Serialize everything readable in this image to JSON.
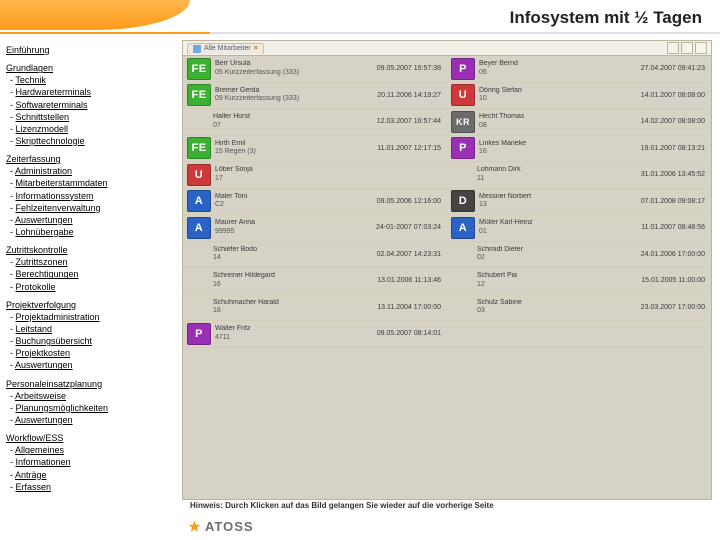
{
  "header": {
    "title": "Infosystem mit ½ Tagen"
  },
  "nav": [
    {
      "title": "Einführung",
      "items": []
    },
    {
      "title": "Grundlagen",
      "items": [
        "Technik",
        "Hardwareterminals",
        "Softwareterminals",
        "Schnittstellen",
        "Lizenzmodell",
        "Skripttechnologie"
      ]
    },
    {
      "title": "Zeiterfassung",
      "items": [
        "Administration",
        "Mitarbeiterstammdaten",
        "Informationssystem",
        "Fehlzeitenverwaltung",
        "Auswertungen",
        "Lohnübergabe"
      ]
    },
    {
      "title": "Zutrittskontrolle",
      "items": [
        "Zutrittszonen",
        "Berechtigungen",
        "Protokolle"
      ]
    },
    {
      "title": "Projektverfolgung",
      "items": [
        "Projektadministration",
        "Leitstand",
        "Buchungsübersicht",
        "Projektkosten",
        "Auswertungen"
      ]
    },
    {
      "title": "Personaleinsatzplanung",
      "items": [
        "Arbeitsweise",
        "Planungsmöglichkeiten",
        "Auswertungen"
      ]
    },
    {
      "title": "Workflow/ESS",
      "items": [
        "Allgemeines",
        "Informationen",
        "Anträge",
        "Erfassen"
      ]
    }
  ],
  "tabs": {
    "active": "Alle Mitarbeiter"
  },
  "rows": [
    {
      "left": {
        "badge": "FE",
        "name": "Berr Ursula",
        "sub": "05",
        "extra": "Kurzzeiterfassung (333)",
        "time": "09.05.2007 15:57:38"
      },
      "right": {
        "badge": "P",
        "name": "Beyer Bernd",
        "sub": "06",
        "time": "27.04.2007 09:41:23"
      }
    },
    {
      "left": {
        "badge": "FE",
        "name": "Bremer Gerda",
        "sub": "09",
        "extra": "Kurzzeiterfassung (333)",
        "time": "20.11.2006 14:19:27"
      },
      "right": {
        "badge": "U",
        "name": "Döring Stefan",
        "sub": "10",
        "time": "14.01.2007 08:08:00"
      }
    },
    {
      "left": {
        "badge": "",
        "name": "Haller Horst",
        "sub": "07",
        "time": "12.03.2007 16:57:44"
      },
      "right": {
        "badge": "KR",
        "name": "Hecht Thomas",
        "sub": "08",
        "time": "14.02.2007 08:08:00"
      }
    },
    {
      "left": {
        "badge": "FE",
        "name": "Hirth Emil",
        "sub": "15",
        "extra": "Regen (3)",
        "time": "11.01.2007 12:17:15"
      },
      "right": {
        "badge": "P",
        "name": "Linkes Marieke",
        "sub": "16",
        "time": "19.01.2007 08:13:21"
      }
    },
    {
      "left": {
        "badge": "U",
        "name": "Löber Sonja",
        "sub": "17",
        "time": ""
      },
      "right": {
        "badge": "",
        "name": "Lohmann Dirk",
        "sub": "11",
        "time": "31.01.2006 13:45:52"
      }
    },
    {
      "left": {
        "badge": "A",
        "name": "Maler Toni",
        "sub": "C2",
        "time": "09.05.2006 12:16:00"
      },
      "right": {
        "badge": "D",
        "name": "Messner Norbert",
        "sub": "13",
        "time": "07.01.2008 09:08:17"
      }
    },
    {
      "left": {
        "badge": "A",
        "name": "Maurer Anna",
        "sub": "99995",
        "time": "24-01-2007 07:03:24"
      },
      "right": {
        "badge": "A",
        "name": "Müller Karl-Heinz",
        "sub": "01",
        "time": "11.01.2007 08:48:56"
      }
    },
    {
      "left": {
        "badge": "",
        "name": "Schiefer Bodo",
        "sub": "14",
        "time": "02.04.2007 14:23:31"
      },
      "right": {
        "badge": "",
        "name": "Schmidt Dieter",
        "sub": "02",
        "time": "24.01.2006 17:00:00"
      }
    },
    {
      "left": {
        "badge": "",
        "name": "Schreiner Hildegard",
        "sub": "16",
        "time": "13.01.2006 11:13:46"
      },
      "right": {
        "badge": "",
        "name": "Schubert Pia",
        "sub": "12",
        "time": "15.01.2005 11:00:00"
      }
    },
    {
      "left": {
        "badge": "",
        "name": "Schuhmacher Harald",
        "sub": "18",
        "time": "13.11.2004 17:00:00"
      },
      "right": {
        "badge": "",
        "name": "Schulz Sabine",
        "sub": "03",
        "time": "23.03.2007 17:00:00"
      }
    },
    {
      "left": {
        "badge": "P",
        "name": "Walter Fritz",
        "sub": "4711",
        "time": "09.05.2007 08:14:01"
      },
      "right": {
        "badge": "",
        "name": "",
        "sub": "",
        "time": ""
      }
    }
  ],
  "hinweis": "Hinweis: Durch Klicken auf das Bild gelangen Sie wieder auf die vorherige Seite",
  "logo": "ATOSS"
}
